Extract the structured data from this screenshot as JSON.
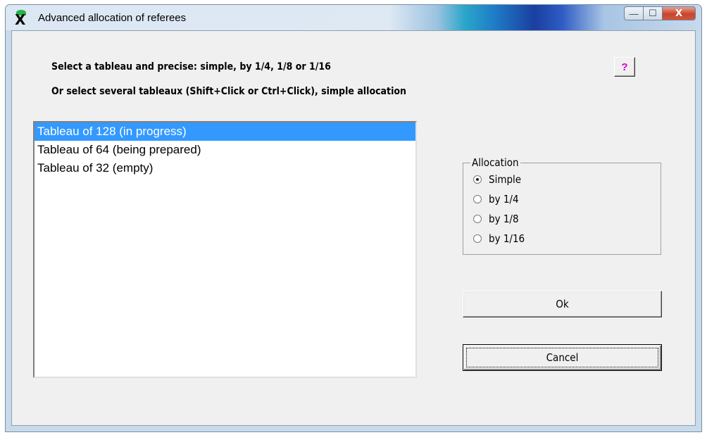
{
  "window": {
    "title": "Advanced allocation of referees",
    "controls": {
      "minimize": "—",
      "maximize": "☐",
      "close": "X"
    }
  },
  "instructions": {
    "line1": "Select a tableau and precise: simple, by 1/4, 1/8 or 1/16",
    "line2": "Or select several tableaux (Shift+Click or Ctrl+Click), simple allocation"
  },
  "help_button": {
    "label": "?",
    "color": "#d400d4"
  },
  "tableaux": {
    "items": [
      {
        "label": "Tableau of 128 (in progress)",
        "selected": true
      },
      {
        "label": "Tableau of 64 (being prepared)",
        "selected": false
      },
      {
        "label": "Tableau of 32 (empty)",
        "selected": false
      }
    ],
    "selection_color": "#3399ff"
  },
  "allocation": {
    "label": "Allocation",
    "options": [
      {
        "label": "Simple",
        "checked": true
      },
      {
        "label": "by 1/4",
        "checked": false
      },
      {
        "label": "by 1/8",
        "checked": false
      },
      {
        "label": "by 1/16",
        "checked": false
      }
    ]
  },
  "buttons": {
    "ok": "Ok",
    "cancel": "Cancel"
  }
}
